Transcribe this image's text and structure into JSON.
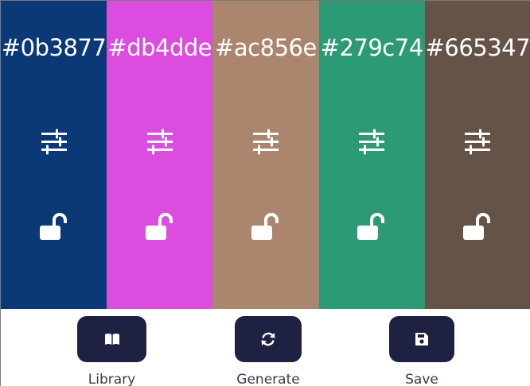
{
  "swatches": [
    {
      "hex": "#0b3877",
      "color": "#0b3877"
    },
    {
      "hex": "#db4dde",
      "color": "#db4dde"
    },
    {
      "hex": "#ac856e",
      "color": "#ac856e"
    },
    {
      "hex": "#279c74",
      "color": "#2c9a74"
    },
    {
      "hex": "#665347",
      "color": "#665347"
    }
  ],
  "icons": {
    "adjust": "sliders-icon",
    "lock": "unlocked-icon"
  },
  "actions": {
    "library": {
      "label": "Library",
      "icon": "book-icon"
    },
    "generate": {
      "label": "Generate",
      "icon": "refresh-icon"
    },
    "save": {
      "label": "Save",
      "icon": "floppy-disk-icon"
    }
  },
  "theme": {
    "button_bg": "#1f2142",
    "label_color": "#3a3a4a"
  }
}
